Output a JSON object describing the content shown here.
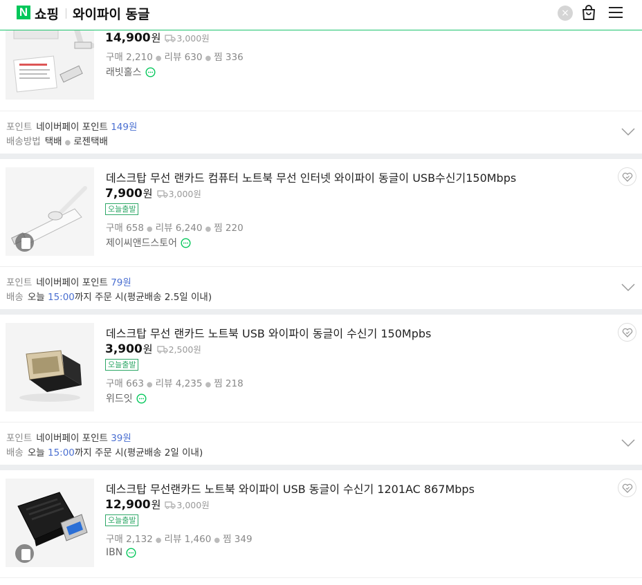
{
  "header": {
    "logo_letter": "N",
    "logo_text": "쇼핑",
    "search_query": "와이파이 동글",
    "clear_label": "×"
  },
  "products": [
    {
      "price": "14,900",
      "won": "원",
      "shipping": "3,000원",
      "stats": {
        "buy_label": "구매",
        "buy": "2,210",
        "review_label": "리뷰",
        "review": "630",
        "zzim_label": "찜",
        "zzim": "336"
      },
      "seller": "래빗홀스",
      "info_key1": "포인트",
      "info_val1": "네이버페이 포인트",
      "info_blue1": "149원",
      "info_key2": "배송방법",
      "info_val2a": "택배",
      "info_val2b": "로젠택배"
    },
    {
      "title": "데스크탑 무선 랜카드 컴퓨터 노트북 무선 인터넷 와이파이 동글이 USB수신기150Mbps",
      "price": "7,900",
      "won": "원",
      "shipping": "3,000원",
      "badge": "오늘출발",
      "stats": {
        "buy_label": "구매",
        "buy": "658",
        "review_label": "리뷰",
        "review": "6,240",
        "zzim_label": "찜",
        "zzim": "220"
      },
      "seller": "제이씨앤드스토어",
      "info_key1": "포인트",
      "info_val1": "네이버페이 포인트",
      "info_blue1": "79원",
      "info_key2": "배송",
      "info_val2a": "오늘",
      "info_blue2": "15:00",
      "info_val2b": "까지 주문 시(평균배송 2.5일 이내)"
    },
    {
      "title": "데스크탑 무선 랜카드 노트북 USB 와이파이 동글이 수신기 150Mpbs",
      "price": "3,900",
      "won": "원",
      "shipping": "2,500원",
      "badge": "오늘출발",
      "stats": {
        "buy_label": "구매",
        "buy": "663",
        "review_label": "리뷰",
        "review": "4,235",
        "zzim_label": "찜",
        "zzim": "218"
      },
      "seller": "위드잇",
      "info_key1": "포인트",
      "info_val1": "네이버페이 포인트",
      "info_blue1": "39원",
      "info_key2": "배송",
      "info_val2a": "오늘",
      "info_blue2": "15:00",
      "info_val2b": "까지 주문 시(평균배송 2일 이내)"
    },
    {
      "title": "데스크탑 무선랜카드 노트북 와이파이 USB 동글이 수신기 1201AC 867Mbps",
      "price": "12,900",
      "won": "원",
      "shipping": "3,000원",
      "badge": "오늘출발",
      "stats": {
        "buy_label": "구매",
        "buy": "2,132",
        "review_label": "리뷰",
        "review": "1,460",
        "zzim_label": "찜",
        "zzim": "349"
      },
      "seller": "IBN"
    }
  ],
  "colors": {
    "brand": "#03c75a",
    "point_blue": "#4a6fd1",
    "badge_green": "#2ca766"
  }
}
